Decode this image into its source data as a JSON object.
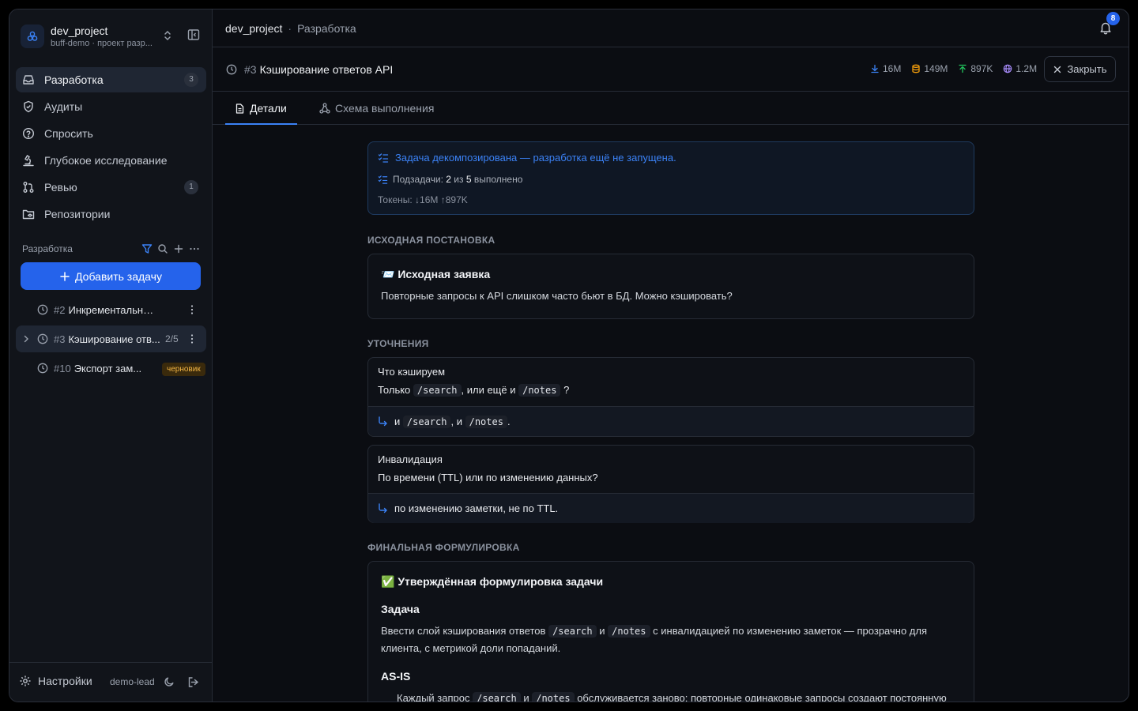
{
  "project": {
    "name": "dev_project",
    "subtitle": "buff-demo · проект разр..."
  },
  "nav": [
    {
      "label": "Разработка",
      "badge": "3",
      "icon": "inbox-icon"
    },
    {
      "label": "Аудиты",
      "icon": "shield-icon"
    },
    {
      "label": "Спросить",
      "icon": "help-circle-icon"
    },
    {
      "label": "Глубокое исследование",
      "icon": "microscope-icon"
    },
    {
      "label": "Ревью",
      "badge": "1",
      "icon": "git-pull-request-icon"
    },
    {
      "label": "Репозитории",
      "icon": "folder-git-icon"
    }
  ],
  "section": {
    "title": "Разработка",
    "add_task": "Добавить задачу"
  },
  "tasks": [
    {
      "num": "#2",
      "name": "Инкрементальная и...",
      "status": "clock"
    },
    {
      "num": "#3",
      "name": "Кэширование отв...",
      "progress": "2/5"
    },
    {
      "num": "#10",
      "name": "Экспорт зам...",
      "badge": "черновик"
    }
  ],
  "footer": {
    "settings": "Настройки",
    "user": "demo-lead"
  },
  "breadcrumb": {
    "project": "dev_project",
    "separator": "·",
    "section": "Разработка"
  },
  "notifications": {
    "count": "8"
  },
  "task_header": {
    "num": "#3",
    "title": "Кэширование ответов API",
    "stats": {
      "down": "16M",
      "cache": "149M",
      "up": "897K",
      "total": "1.2M"
    },
    "close_label": "Закрыть"
  },
  "tabs": {
    "details": "Детали",
    "flow": "Схема выполнения"
  },
  "notice": {
    "line1": "Задача декомпозирована — разработка ещё не запущена.",
    "subtasks_label": "Подзадачи:",
    "subtasks_done": "2",
    "subtasks_of": "из",
    "subtasks_total": "5",
    "subtasks_suffix": "выполнено",
    "tokens": "Токены: ↓16M ↑897K"
  },
  "original": {
    "section": "Исходная постановка",
    "title": "📨 Исходная заявка",
    "text": "Повторные запросы к API слишком часто бьют в БД. Можно кэшировать?"
  },
  "clarifications": {
    "section": "Уточнения",
    "items": [
      {
        "title": "Что кэшируем",
        "q_pre": "Только",
        "q_code1": "/search",
        "q_mid": ", или ещё и",
        "q_code2": "/notes",
        "q_post": "?",
        "a_pre": "и",
        "a_code1": "/search",
        "a_mid": ", и",
        "a_code2": "/notes",
        "a_post": "."
      },
      {
        "title": "Инвалидация",
        "question": "По времени (TTL) или по изменению данных?",
        "answer": "по изменению заметки, не по TTL."
      }
    ]
  },
  "final": {
    "section": "Финальная формулировка",
    "title": "✅ Утверждённая формулировка задачи",
    "task_heading": "Задача",
    "task_pre": "Ввести слой кэширования ответов",
    "task_code1": "/search",
    "task_mid": "и",
    "task_code2": "/notes",
    "task_post": "с инвалидацией по изменению заметок — прозрачно для клиента, с метрикой доли попаданий.",
    "asis_heading": "AS-IS",
    "asis_bullet_pre": "Каждый запрос",
    "asis_code1": "/search",
    "asis_mid": "и",
    "asis_code2": "/notes",
    "asis_post": "обслуживается заново; повторные одинаковые запросы создают постоянную"
  },
  "colors": {
    "accent": "#2563eb",
    "link": "#3b82f6",
    "draft": "#f2b544"
  }
}
